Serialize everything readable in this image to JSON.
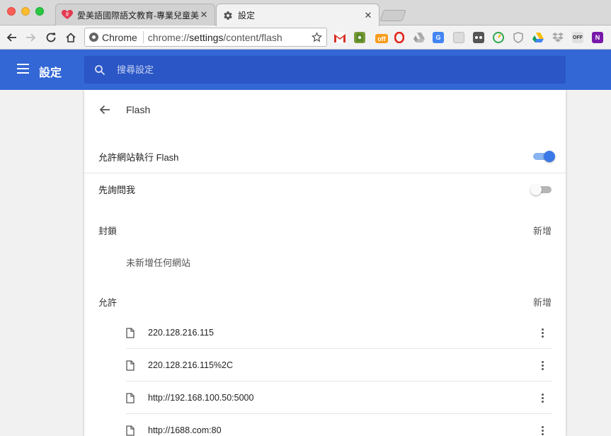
{
  "tabs": [
    {
      "title": "愛美語國際語文教育-專業兒童美",
      "active": false,
      "close": "✕"
    },
    {
      "title": "設定",
      "active": true,
      "close": "✕"
    }
  ],
  "omnibox": {
    "chip": "Chrome",
    "url_prefix": "chrome://",
    "url_bold": "settings",
    "url_rest": "/content/flash"
  },
  "extensions": [
    "gmail-icon",
    "evernote-icon",
    "off-icon",
    "opera-icon",
    "drive-gray-icon",
    "translate-icon",
    "calendar-icon",
    "tasks-icon",
    "speedometer-icon",
    "shield-icon",
    "google-drive-icon",
    "dropbox-icon",
    "office-off-icon",
    "onenote-icon"
  ],
  "ext_labels": {
    "off": "off",
    "office": "OFF",
    "onenote": "N"
  },
  "appbar": {
    "title": "設定",
    "search_placeholder": "搜尋設定"
  },
  "page": {
    "title": "Flash",
    "allow_flash_label": "允許網站執行 Flash",
    "allow_flash_on": true,
    "ask_first_label": "先詢問我",
    "ask_first_on": false,
    "block_section": "封鎖",
    "block_add": "新增",
    "block_empty": "未新增任何網站",
    "allow_section": "允許",
    "allow_add": "新增",
    "allowed_sites": [
      "220.128.216.115",
      "220.128.216.115%2C",
      "http://192.168.100.50:5000",
      "http://1688.com:80"
    ]
  },
  "colors": {
    "appbar": "#3367d6",
    "search": "#2a56c6",
    "toggle_on": "#3b78e7"
  }
}
